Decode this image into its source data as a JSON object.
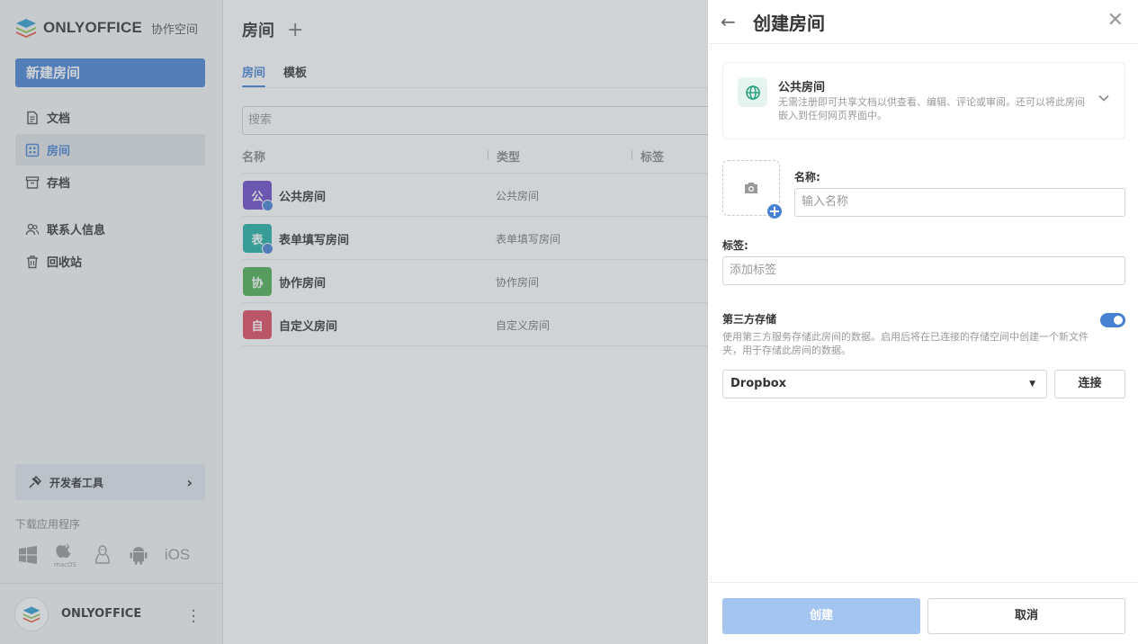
{
  "colors": {
    "accent": "#4781d1",
    "sidebar_bg": "#f3f4f4",
    "overlay": "rgba(110,118,128,0.32)",
    "create_disabled": "#a3c5ef"
  },
  "sidebar": {
    "logo_text": "ONLYOFFICE",
    "logo_sub": "协作空间",
    "new_room_label": "新建房间",
    "nav": [
      {
        "label": "文档",
        "icon": "document-icon"
      },
      {
        "label": "房间",
        "icon": "rooms-grid-icon",
        "active": true
      },
      {
        "label": "存档",
        "icon": "archive-icon"
      },
      {
        "label": "联系人信息",
        "icon": "contacts-icon"
      },
      {
        "label": "回收站",
        "icon": "trash-icon"
      }
    ],
    "dev_tools_label": "开发者工具",
    "download_label": "下载应用程序",
    "os": [
      "windows-icon",
      "macos-icon",
      "linux-icon",
      "android-icon",
      "ios-icon"
    ],
    "macos_caption": "macOS",
    "ios_label": "iOS",
    "profile_name": "ONLYOFFICE"
  },
  "main": {
    "title": "房间",
    "tabs": [
      "房间",
      "模板"
    ],
    "search_placeholder": "搜索",
    "columns": [
      "名称",
      "类型",
      "标签"
    ],
    "rooms": [
      {
        "letter": "公",
        "name": "公共房间",
        "type": "公共房间",
        "color": "#6b49c8",
        "shared": true
      },
      {
        "letter": "表",
        "name": "表单填写房间",
        "type": "表单填写房间",
        "color": "#1fb0a2",
        "shared": true
      },
      {
        "letter": "协",
        "name": "协作房间",
        "type": "协作房间",
        "color": "#4caf50",
        "shared": false
      },
      {
        "letter": "自",
        "name": "自定义房间",
        "type": "自定义房间",
        "color": "#e1475e",
        "shared": false
      }
    ]
  },
  "panel": {
    "title": "创建房间",
    "room_type_title": "公共房间",
    "room_type_desc": "无需注册即可共享文档以供查看、编辑、评论或审阅。还可以将此房间嵌入到任何网页界面中。",
    "name_label": "名称:",
    "name_placeholder": "输入名称",
    "tags_label": "标签:",
    "tags_placeholder": "添加标签",
    "storage_title": "第三方存储",
    "storage_enabled": true,
    "storage_desc": "使用第三方服务存储此房间的数据。启用后将在已连接的存储空间中创建一个新文件夹，用于存储此房间的数据。",
    "storage_provider": "Dropbox",
    "connect_label": "连接",
    "create_label": "创建",
    "cancel_label": "取消"
  }
}
